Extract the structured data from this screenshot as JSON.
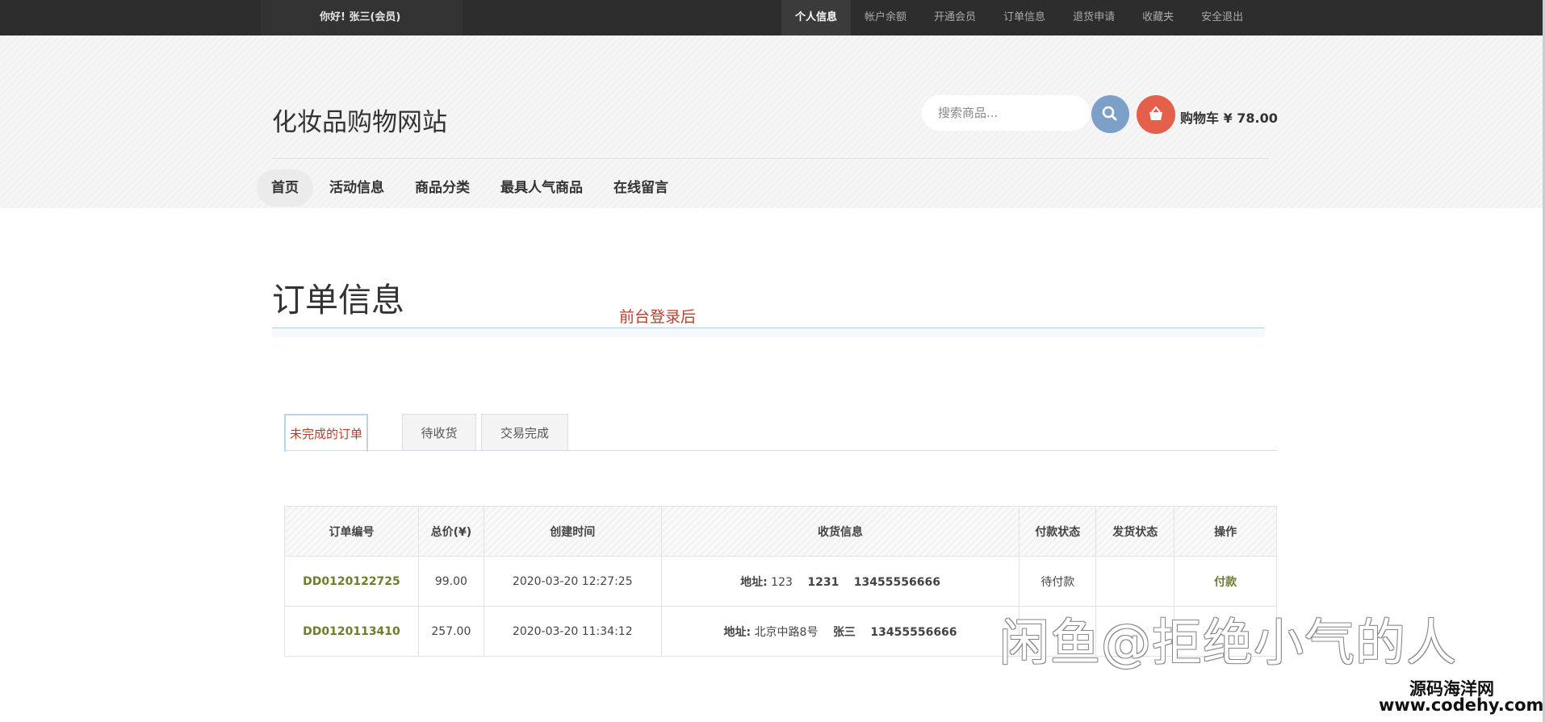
{
  "topbar": {
    "greeting": "你好!  张三(会员)",
    "nav": [
      {
        "label": "个人信息",
        "active": true
      },
      {
        "label": "帐户余额"
      },
      {
        "label": "开通会员"
      },
      {
        "label": "订单信息"
      },
      {
        "label": "退货申请"
      },
      {
        "label": "收藏夹"
      },
      {
        "label": "安全退出"
      }
    ]
  },
  "header": {
    "site_title": "化妆品购物网站",
    "search_placeholder": "搜索商品...",
    "cart_text": "购物车 ¥ 78.00",
    "search_icon": "search-icon",
    "cart_icon": "basket-icon"
  },
  "mainnav": [
    {
      "label": "首页",
      "active": true
    },
    {
      "label": "活动信息"
    },
    {
      "label": "商品分类"
    },
    {
      "label": "最具人气商品"
    },
    {
      "label": "在线留言"
    }
  ],
  "page": {
    "title": "订单信息",
    "annotation": "前台登录后"
  },
  "tabs": [
    {
      "label": "未完成的订单",
      "active": true
    },
    {
      "label": "待收货"
    },
    {
      "label": "交易完成"
    }
  ],
  "table": {
    "headers": [
      "订单编号",
      "总价(¥)",
      "创建时间",
      "收货信息",
      "付款状态",
      "发货状态",
      "操作"
    ],
    "rows": [
      {
        "order_no": "DD0120122725",
        "total": "99.00",
        "created": "2020-03-20 12:27:25",
        "addr_label": "地址:",
        "addr": "123",
        "name": "1231",
        "phone": "13455556666",
        "pay_status": "待付款",
        "ship_status": "",
        "action": "付款"
      },
      {
        "order_no": "DD0120113410",
        "total": "257.00",
        "created": "2020-03-20 11:34:12",
        "addr_label": "地址:",
        "addr": "北京中路8号",
        "name": "张三",
        "phone": "13455556666",
        "pay_status": "",
        "ship_status": "",
        "action": ""
      }
    ]
  },
  "watermarks": {
    "big": "闲鱼@拒绝小气的人",
    "site_name": "源码海洋网",
    "site_url": "www.codehy.com"
  },
  "colors": {
    "topbar": "#2d2d2d",
    "accent_red": "#c0392b",
    "order_green": "#6b7f2a",
    "search_blue": "#7da0c8",
    "cart_orange": "#e5604a"
  }
}
